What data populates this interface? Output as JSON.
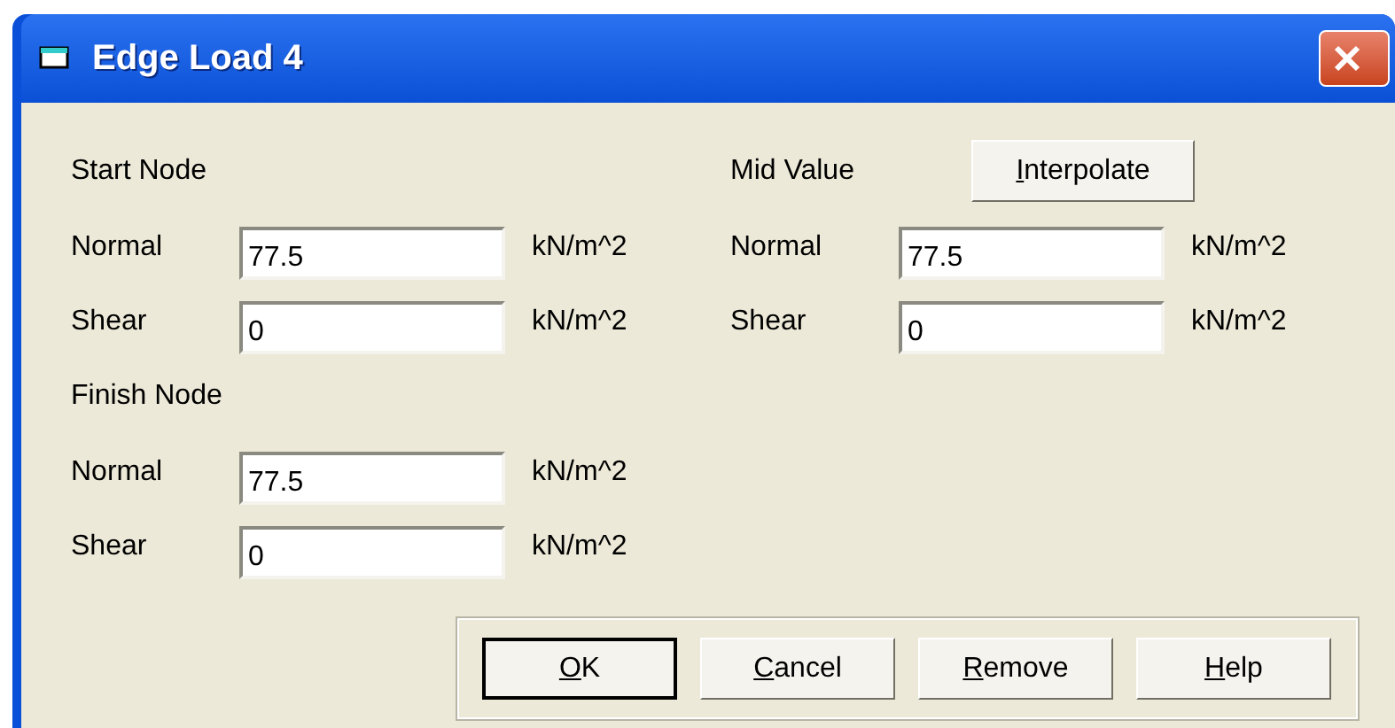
{
  "window": {
    "title": "Edge Load 4"
  },
  "start_node": {
    "heading": "Start Node",
    "fields": [
      {
        "label": "Normal",
        "value": "77.5",
        "unit": "kN/m^2"
      },
      {
        "label": "Shear",
        "value": "0",
        "unit": "kN/m^2"
      }
    ]
  },
  "mid_value": {
    "heading": "Mid Value",
    "button": {
      "label": "Interpolate",
      "underline_first": true
    },
    "fields": [
      {
        "label": "Normal",
        "value": "77.5",
        "unit": "kN/m^2"
      },
      {
        "label": "Shear",
        "value": "0",
        "unit": "kN/m^2"
      }
    ]
  },
  "finish_node": {
    "heading": "Finish Node",
    "fields": [
      {
        "label": "Normal",
        "value": "77.5",
        "unit": "kN/m^2"
      },
      {
        "label": "Shear",
        "value": "0",
        "unit": "kN/m^2"
      }
    ]
  },
  "buttons": [
    {
      "label": "OK",
      "underline_first": true,
      "default": true
    },
    {
      "label": "Cancel",
      "underline_first": true,
      "default": false
    },
    {
      "label": "Remove",
      "underline_first": true,
      "default": false
    },
    {
      "label": "Help",
      "underline_first": true,
      "default": false
    }
  ]
}
